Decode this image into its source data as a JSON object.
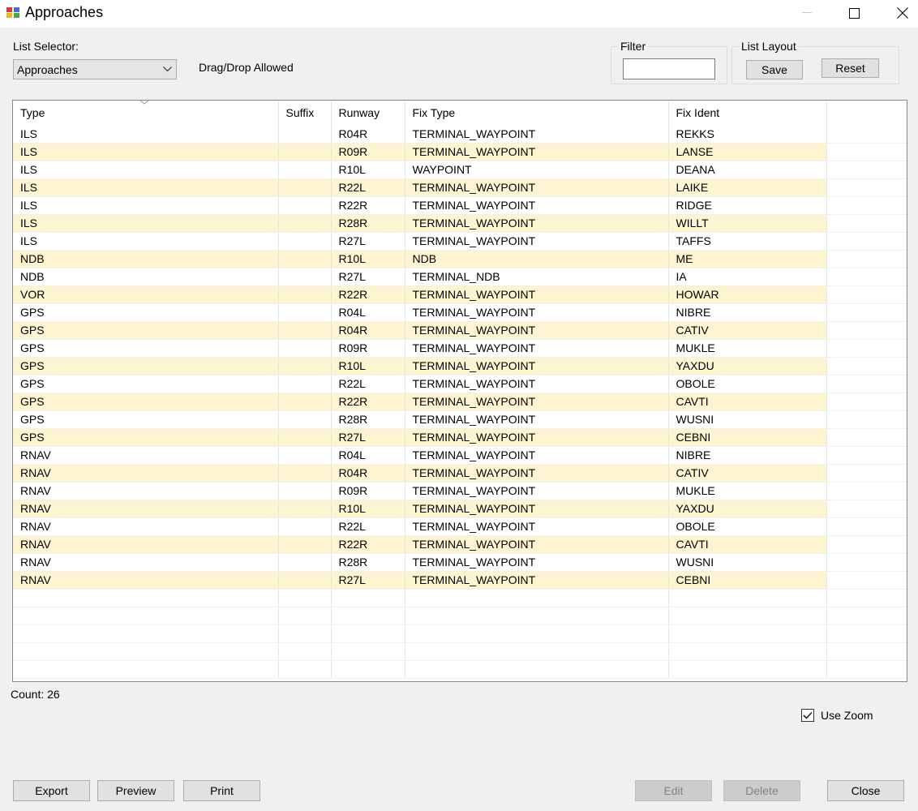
{
  "window": {
    "title": "Approaches"
  },
  "list_selector": {
    "label": "List Selector:",
    "value": "Approaches"
  },
  "drag_drop_text": "Drag/Drop Allowed",
  "filter": {
    "label": "Filter",
    "value": ""
  },
  "list_layout": {
    "label": "List Layout",
    "save_label": "Save",
    "reset_label": "Reset"
  },
  "grid": {
    "columns": [
      "Type",
      "Suffix",
      "Runway",
      "Fix Type",
      "Fix Ident"
    ],
    "sorted_column": "Type",
    "rows": [
      [
        "ILS",
        "",
        "R04R",
        "TERMINAL_WAYPOINT",
        "REKKS"
      ],
      [
        "ILS",
        "",
        "R09R",
        "TERMINAL_WAYPOINT",
        "LANSE"
      ],
      [
        "ILS",
        "",
        "R10L",
        "WAYPOINT",
        "DEANA"
      ],
      [
        "ILS",
        "",
        "R22L",
        "TERMINAL_WAYPOINT",
        "LAIKE"
      ],
      [
        "ILS",
        "",
        "R22R",
        "TERMINAL_WAYPOINT",
        "RIDGE"
      ],
      [
        "ILS",
        "",
        "R28R",
        "TERMINAL_WAYPOINT",
        "WILLT"
      ],
      [
        "ILS",
        "",
        "R27L",
        "TERMINAL_WAYPOINT",
        "TAFFS"
      ],
      [
        "NDB",
        "",
        "R10L",
        "NDB",
        "ME"
      ],
      [
        "NDB",
        "",
        "R27L",
        "TERMINAL_NDB",
        "IA"
      ],
      [
        "VOR",
        "",
        "R22R",
        "TERMINAL_WAYPOINT",
        "HOWAR"
      ],
      [
        "GPS",
        "",
        "R04L",
        "TERMINAL_WAYPOINT",
        "NIBRE"
      ],
      [
        "GPS",
        "",
        "R04R",
        "TERMINAL_WAYPOINT",
        "CATIV"
      ],
      [
        "GPS",
        "",
        "R09R",
        "TERMINAL_WAYPOINT",
        "MUKLE"
      ],
      [
        "GPS",
        "",
        "R10L",
        "TERMINAL_WAYPOINT",
        "YAXDU"
      ],
      [
        "GPS",
        "",
        "R22L",
        "TERMINAL_WAYPOINT",
        "OBOLE"
      ],
      [
        "GPS",
        "",
        "R22R",
        "TERMINAL_WAYPOINT",
        "CAVTI"
      ],
      [
        "GPS",
        "",
        "R28R",
        "TERMINAL_WAYPOINT",
        "WUSNI"
      ],
      [
        "GPS",
        "",
        "R27L",
        "TERMINAL_WAYPOINT",
        "CEBNI"
      ],
      [
        "RNAV",
        "",
        "R04L",
        "TERMINAL_WAYPOINT",
        "NIBRE"
      ],
      [
        "RNAV",
        "",
        "R04R",
        "TERMINAL_WAYPOINT",
        "CATIV"
      ],
      [
        "RNAV",
        "",
        "R09R",
        "TERMINAL_WAYPOINT",
        "MUKLE"
      ],
      [
        "RNAV",
        "",
        "R10L",
        "TERMINAL_WAYPOINT",
        "YAXDU"
      ],
      [
        "RNAV",
        "",
        "R22L",
        "TERMINAL_WAYPOINT",
        "OBOLE"
      ],
      [
        "RNAV",
        "",
        "R22R",
        "TERMINAL_WAYPOINT",
        "CAVTI"
      ],
      [
        "RNAV",
        "",
        "R28R",
        "TERMINAL_WAYPOINT",
        "WUSNI"
      ],
      [
        "RNAV",
        "",
        "R27L",
        "TERMINAL_WAYPOINT",
        "CEBNI"
      ]
    ]
  },
  "count_text": "Count: 26",
  "use_zoom": {
    "label": "Use Zoom",
    "checked": true
  },
  "footer": {
    "export_label": "Export",
    "preview_label": "Preview",
    "print_label": "Print",
    "edit_label": "Edit",
    "delete_label": "Delete",
    "close_label": "Close"
  },
  "colors": {
    "alt_row": "#fdf5d2",
    "window_bg": "#f0f0f0",
    "disabled_button": "#cccccc"
  },
  "icons": [
    "app-icon",
    "minimize-icon",
    "maximize-icon",
    "close-icon",
    "chevron-down-icon",
    "sort-indicator-icon",
    "checkmark-icon"
  ]
}
